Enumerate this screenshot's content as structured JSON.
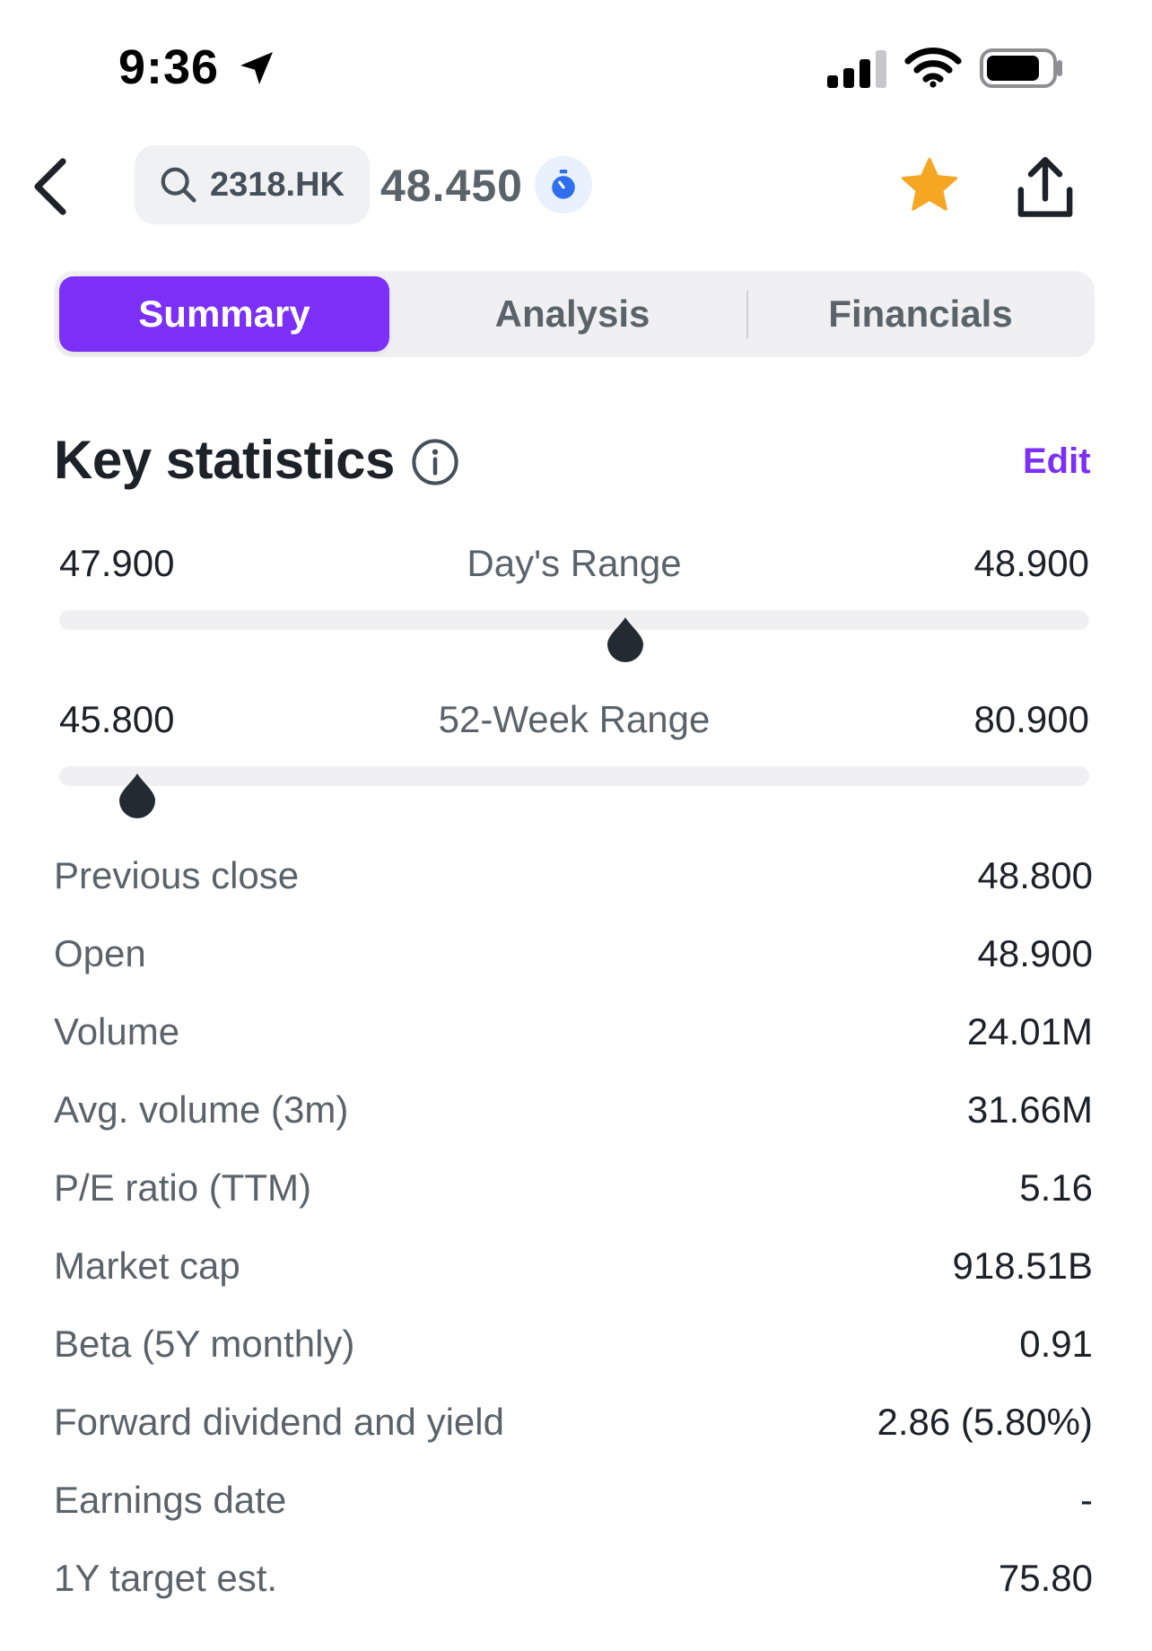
{
  "status_bar": {
    "time": "9:36",
    "icons": [
      "location-arrow-icon",
      "cellular-signal-icon",
      "wifi-icon",
      "battery-icon"
    ]
  },
  "header": {
    "icons": [
      "chevron-left-icon",
      "search-icon",
      "timer-icon",
      "star-icon",
      "share-icon"
    ],
    "ticker": "2318.HK",
    "price": "48.450",
    "star_color": "#f5a623",
    "timer_color": "#2f6fed"
  },
  "tabs": [
    {
      "label": "Summary",
      "active": true
    },
    {
      "label": "Analysis",
      "active": false
    },
    {
      "label": "Financials",
      "active": false
    }
  ],
  "accent_color": "#7b2ff7",
  "key_statistics": {
    "title": "Key statistics",
    "edit_label": "Edit",
    "days_range": {
      "label": "Day's Range",
      "low": "47.900",
      "high": "48.900",
      "current": 48.45
    },
    "week52_range": {
      "label": "52-Week Range",
      "low": "45.800",
      "high": "80.900",
      "current": 48.45
    },
    "rows": [
      {
        "label": "Previous close",
        "value": "48.800"
      },
      {
        "label": "Open",
        "value": "48.900"
      },
      {
        "label": "Volume",
        "value": "24.01M"
      },
      {
        "label": "Avg. volume (3m)",
        "value": "31.66M"
      },
      {
        "label": "P/E ratio (TTM)",
        "value": "5.16"
      },
      {
        "label": "Market cap",
        "value": "918.51B"
      },
      {
        "label": "Beta (5Y monthly)",
        "value": "0.91"
      },
      {
        "label": "Forward dividend and yield",
        "value": "2.86 (5.80%)"
      },
      {
        "label": "Earnings date",
        "value": "-"
      },
      {
        "label": "1Y target est.",
        "value": "75.80"
      }
    ]
  }
}
